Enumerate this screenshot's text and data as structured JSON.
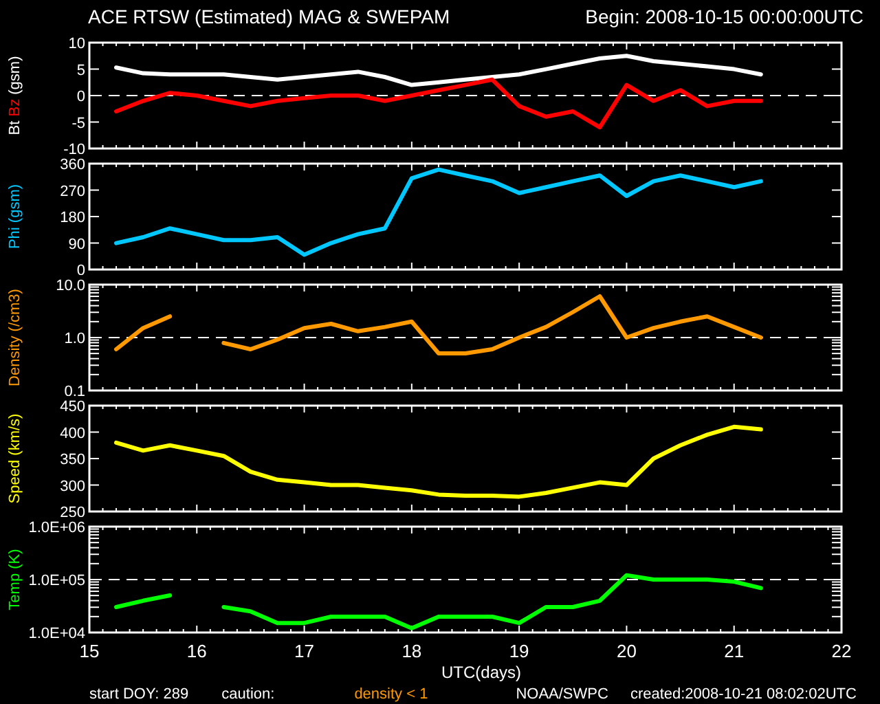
{
  "title": "ACE RTSW (Estimated) MAG & SWEPAM",
  "begin": "Begin: 2008-10-15 00:00:00UTC",
  "panels": [
    {
      "label_parts": [
        {
          "text": "Bt",
          "color": "#ffffff"
        },
        {
          "text": "Bz",
          "color": "#ff0000"
        },
        {
          "text": "(gsm)",
          "color": "#ffffff"
        }
      ],
      "midline": true,
      "chart_data": {
        "type": "line",
        "categories": [
          null,
          null,
          null,
          null,
          null,
          null,
          null,
          null,
          null,
          null,
          null,
          null,
          null,
          null,
          null,
          null,
          null,
          null,
          null,
          null,
          null,
          null,
          null,
          null,
          null
        ],
        "ylim": [
          -10,
          10
        ],
        "yticks": [
          10,
          5,
          0,
          -5,
          -10
        ],
        "series": [
          {
            "color": "#ffffff",
            "values": [
              5.3,
              4.2,
              4,
              4,
              4,
              3.5,
              3,
              3.5,
              4,
              4.5,
              3.5,
              2,
              2.5,
              3,
              3.5,
              4,
              5,
              6,
              7,
              7.5,
              6.5,
              6,
              5.5,
              5,
              4
            ]
          },
          {
            "color": "#ff0000",
            "values": [
              -3,
              -1,
              0.5,
              0,
              -1,
              -2,
              -1,
              -0.5,
              0,
              0,
              -1,
              0,
              1,
              2,
              3,
              -2,
              -4,
              -3,
              -6,
              2,
              -1,
              1,
              -2,
              -1,
              -1
            ]
          }
        ]
      }
    },
    {
      "label_parts": [
        {
          "text": "Phi (gsm)",
          "color": "#00c8ff"
        }
      ],
      "midline": false,
      "chart_data": {
        "type": "line",
        "categories": [
          null,
          null,
          null,
          null,
          null,
          null,
          null,
          null,
          null,
          null,
          null,
          null,
          null,
          null,
          null,
          null,
          null,
          null,
          null,
          null,
          null,
          null,
          null,
          null,
          null
        ],
        "ylim": [
          0,
          360
        ],
        "yticks": [
          0,
          90,
          180,
          270,
          360
        ],
        "series": [
          {
            "color": "#00c8ff",
            "values": [
              90,
              110,
              140,
              120,
              100,
              100,
              110,
              50,
              90,
              120,
              140,
              310,
              340,
              320,
              300,
              260,
              280,
              300,
              320,
              250,
              300,
              320,
              300,
              280,
              300
            ]
          }
        ]
      }
    },
    {
      "label_parts": [
        {
          "text": "Density (/cm3)",
          "color": "#ff9900"
        }
      ],
      "midline": true,
      "tick_labels": [
        "10.0",
        "1.0",
        "0.1"
      ]
    },
    {
      "label_parts": [
        {
          "text": "Speed (km/s)",
          "color": "#ffff00"
        }
      ],
      "midline": false,
      "chart_data": {
        "type": "line",
        "categories": [
          null,
          null,
          null,
          null,
          null,
          null,
          null,
          null,
          null,
          null,
          null,
          null,
          null,
          null,
          null,
          null,
          null,
          null,
          null,
          null,
          null,
          null,
          null,
          null,
          null
        ],
        "ylim": [
          250,
          450
        ],
        "yticks": [
          450,
          400,
          350,
          300,
          250
        ],
        "series": [
          {
            "color": "#ffff00",
            "values": [
              380,
              365,
              375,
              365,
              355,
              325,
              310,
              305,
              300,
              300,
              295,
              290,
              282,
              280,
              280,
              278,
              285,
              295,
              305,
              300,
              350,
              375,
              395,
              410,
              405
            ]
          }
        ]
      }
    },
    {
      "label_parts": [
        {
          "text": "Temp (K)",
          "color": "#00ff00"
        }
      ],
      "midline": true,
      "tick_labels": [
        "1.0E+06",
        "1.0E+05",
        "1.0E+04"
      ]
    }
  ],
  "x_axis": {
    "tick_labels": [
      "15",
      "16",
      "17",
      "18",
      "19",
      "20",
      "21",
      "22"
    ],
    "label": "UTC(days)"
  },
  "footer": {
    "start": "start DOY: 289",
    "caution": "caution:",
    "caution_note": "density < 1",
    "source": "NOAA/SWPC",
    "created": "created:2008-10-21 08:02:02UTC"
  }
}
